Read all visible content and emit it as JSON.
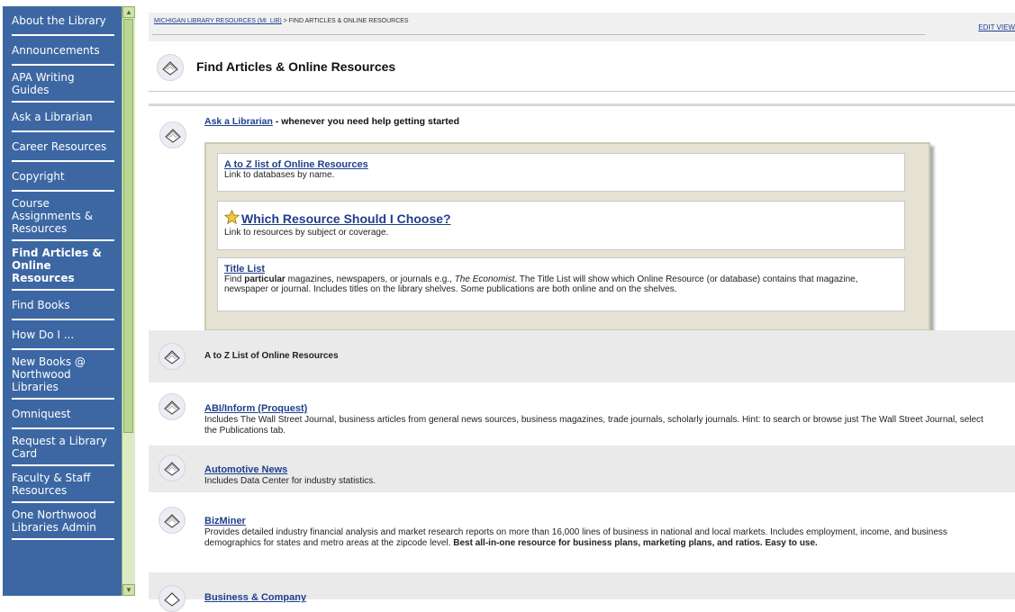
{
  "sidebar": {
    "items": [
      {
        "label": "About the Library"
      },
      {
        "label": "Announcements"
      },
      {
        "label": "APA Writing Guides"
      },
      {
        "label": "Ask a Librarian"
      },
      {
        "label": "Career Resources"
      },
      {
        "label": "Copyright"
      },
      {
        "label": "Course Assignments & Resources"
      },
      {
        "label": "Find Articles & Online Resources"
      },
      {
        "label": "Find Books"
      },
      {
        "label": "How Do I ..."
      },
      {
        "label": "New Books @ Northwood Libraries"
      },
      {
        "label": "Omniquest"
      },
      {
        "label": "Request a Library Card"
      },
      {
        "label": "Faculty & Staff Resources"
      },
      {
        "label": "One Northwood Libraries Admin"
      }
    ]
  },
  "breadcrumb": {
    "link": "MICHIGAN LIBRARY RESOURCES (MI_LIB)",
    "sep": " > ",
    "current": "FIND ARTICLES & ONLINE RESOURCES"
  },
  "edit_view": "EDIT VIEW",
  "page_title": "Find Articles & Online Resources",
  "ask": {
    "link": "Ask a Librarian",
    "rest": " - whenever you need help getting started"
  },
  "box": {
    "az": {
      "title": "A to Z list of Online Resources",
      "desc": "Link to databases by name."
    },
    "which": {
      "title": "Which Resource Should I Choose?",
      "desc": "Link to resources by subject or coverage."
    },
    "title_list": {
      "title": "Title List",
      "desc_1": "Find ",
      "desc_bold": "particular",
      "desc_2": " magazines, newspapers, or journals e.g., ",
      "desc_em": "The Economist",
      "desc_3": ". The Title List will show which Online Resource (or database) contains that magazine, newspaper or journal. Includes titles on the library shelves. Some publications are both online and on the shelves."
    }
  },
  "az_header": "A to Z List of Online Resources",
  "resources": {
    "abi": {
      "title": "ABI/Inform (Proquest)",
      "desc": "Includes The Wall Street Journal, business articles from general news sources, business magazines, trade journals, scholarly journals. Hint: to search or browse just The Wall Street Journal, select the Publications tab."
    },
    "auto": {
      "title": "Automotive News",
      "desc": "Includes Data Center for industry statistics."
    },
    "biz": {
      "title": "BizMiner",
      "desc": "Provides detailed industry financial analysis and market research reports on more than 16,000 lines of business in national and local markets. Includes employment, income, and business demographics for states and metro areas at the zipcode level. ",
      "desc_bold": "Best all-in-one resource for business plans, marketing plans, and ratios. Easy to use."
    },
    "bc": {
      "title": "Business & Company"
    }
  }
}
